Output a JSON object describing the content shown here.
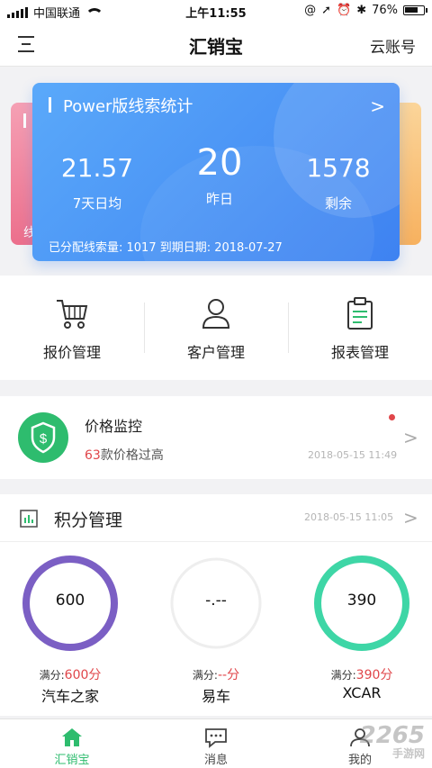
{
  "status_bar": {
    "carrier": "中国联通",
    "time": "上午11:55",
    "battery": "76%",
    "battery_level": 0.76
  },
  "navbar": {
    "title": "汇销宝",
    "right_label": "云账号"
  },
  "side_cards": {
    "left_text": "线"
  },
  "card": {
    "title": "Power版线索统计",
    "stats": [
      {
        "value": "21.57",
        "label": "7天日均"
      },
      {
        "value": "20",
        "label": "昨日"
      },
      {
        "value": "1578",
        "label": "剩余"
      }
    ],
    "footer": "已分配线索量: 1017   到期日期: 2018-07-27"
  },
  "quick_menu": [
    {
      "label": "报价管理",
      "icon": "shopping-cart-icon"
    },
    {
      "label": "客户管理",
      "icon": "person-icon"
    },
    {
      "label": "报表管理",
      "icon": "clipboard-icon"
    }
  ],
  "monitor": {
    "title": "价格监控",
    "count": "63",
    "suffix": "款价格过高",
    "time": "2018-05-15 11:49"
  },
  "points": {
    "title": "积分管理",
    "time": "2018-05-15 11:05",
    "gauges": [
      {
        "value": "600",
        "max_label": "满分:",
        "max": "600分",
        "name": "汽车之家",
        "fraction": 1.0,
        "color": "#7b5fc4"
      },
      {
        "value": "-.--",
        "max_label": "满分:",
        "max": "--分",
        "name": "易车",
        "fraction": 0.0,
        "color": "#cccccc"
      },
      {
        "value": "390",
        "max_label": "满分:",
        "max": "390分",
        "name": "XCAR",
        "fraction": 1.0,
        "color": "#3ed6a6"
      }
    ]
  },
  "tabbar": [
    {
      "label": "汇销宝",
      "icon": "home-icon",
      "active": true
    },
    {
      "label": "消息",
      "icon": "message-icon",
      "active": false
    },
    {
      "label": "我的",
      "icon": "user-icon",
      "active": false
    }
  ],
  "watermark": {
    "main": "2265",
    "sub": "手游网"
  },
  "colors": {
    "accent": "#2ebc6e",
    "card_blue": "#3e82f1",
    "alert_red": "#e0464a"
  }
}
